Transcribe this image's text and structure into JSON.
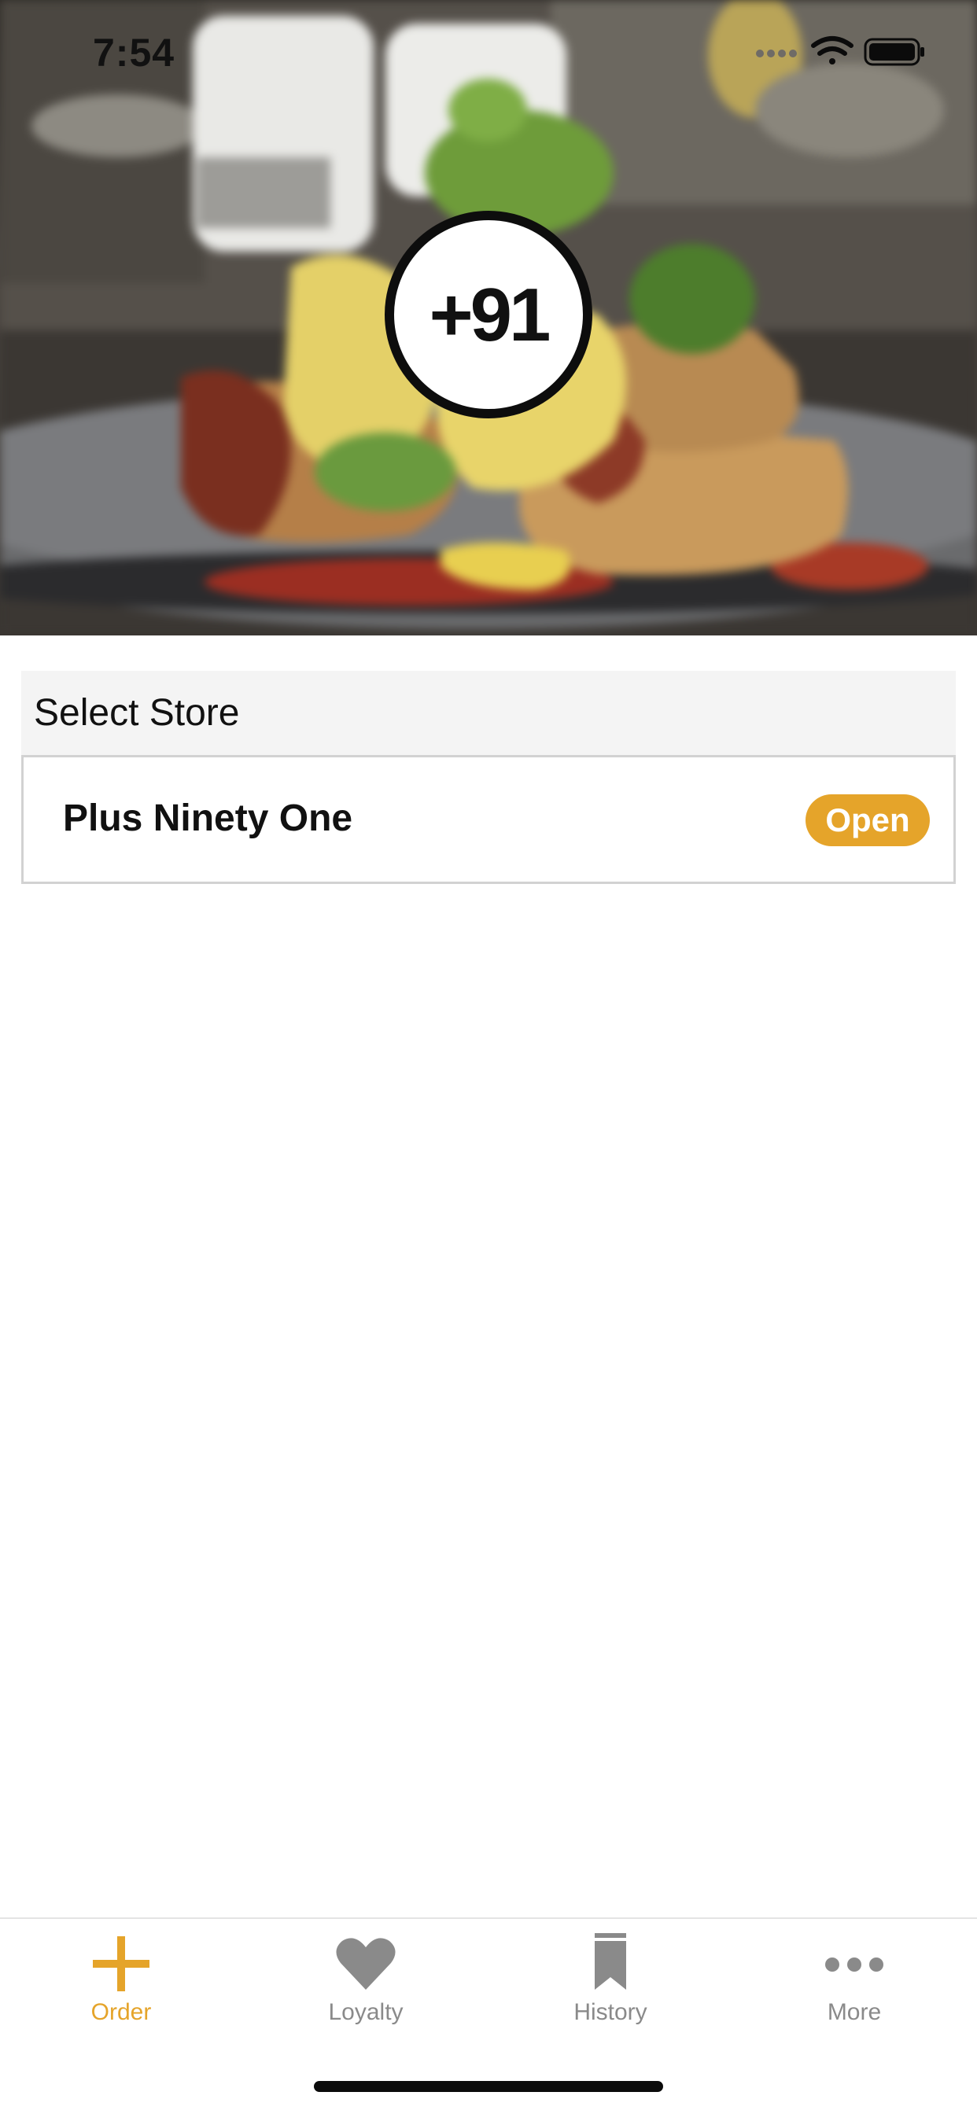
{
  "status_bar": {
    "time": "7:54"
  },
  "hero": {
    "logo_text": "+91"
  },
  "store_section": {
    "header": "Select Store",
    "stores": [
      {
        "name": "Plus Ninety One",
        "status": "Open"
      }
    ]
  },
  "tab_bar": {
    "tabs": [
      {
        "label": "Order",
        "icon": "plus-icon",
        "active": true
      },
      {
        "label": "Loyalty",
        "icon": "heart-icon",
        "active": false
      },
      {
        "label": "History",
        "icon": "bookmark-icon",
        "active": false
      },
      {
        "label": "More",
        "icon": "more-dots-icon",
        "active": false
      }
    ]
  },
  "colors": {
    "accent": "#E5A42A",
    "inactive": "#8A8A8A",
    "text": "#111111"
  }
}
